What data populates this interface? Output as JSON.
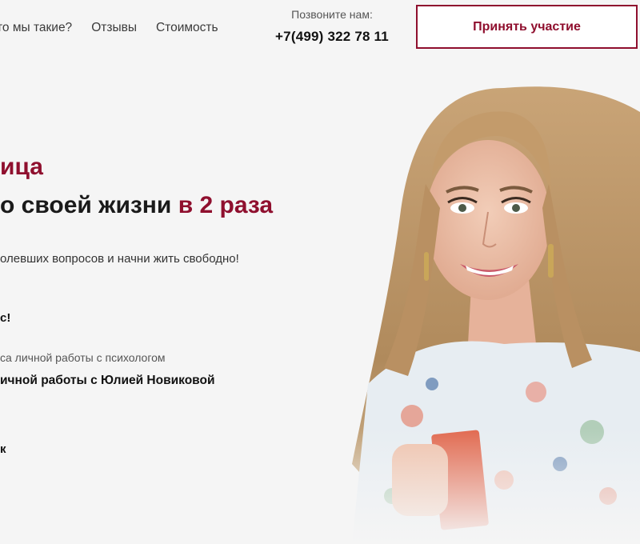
{
  "header": {
    "nav": [
      {
        "label": "то мы такие?"
      },
      {
        "label": "Отзывы"
      },
      {
        "label": "Стоимость"
      }
    ],
    "phone_label": "Позвоните нам:",
    "phone_number": "+7(499) 322 78 11",
    "cta_label": "Принять участие"
  },
  "hero": {
    "line1": "ица",
    "line2_part1": "о своей жизни ",
    "line2_accent": "в 2 раза",
    "subtitle": "олевших вопросов и начни жить свободно!",
    "cta_text": "с!",
    "bonus_small": "са личной работы с психологом",
    "bonus_big": "ичной работы с Юлией Новиковой",
    "gift_text": "к"
  },
  "colors": {
    "accent": "#8f0f2e",
    "background": "#f5f5f5",
    "text": "#1a1a1a"
  }
}
